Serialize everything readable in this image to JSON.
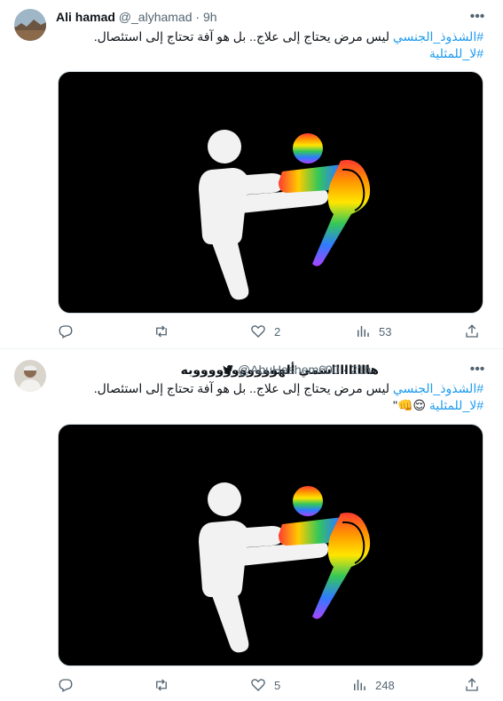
{
  "tweets": [
    {
      "name": "Ali hamad",
      "handle": "@_alyhamad",
      "separator": "·",
      "time": "9h",
      "body_hashtag": "#الشذوذ_الجنسي",
      "body_text": " ليس مرض يحتاج إلى علاج.. بل هو آفة تحتاج إلى استئصال.",
      "body_hashtag2": "#لا_للمثلية",
      "body_suffix": "",
      "replies": "",
      "retweets": "",
      "likes": "2",
      "views": "53"
    },
    {
      "name": "هاااااااااشمي ألهوووووووووووبه",
      "handle": "@AbuHashem600",
      "separator": "·",
      "time": "21h",
      "body_hashtag": "#الشذوذ_الجنسي",
      "body_text": " ليس مرض يحتاج إلى علاج.. بل هو آفة تحتاج إلى استئصال.",
      "body_hashtag2": "#لا_للمثلية",
      "body_suffix": " 😌👊\"",
      "replies": "",
      "retweets": "",
      "likes": "5",
      "views": "248"
    }
  ],
  "icons": {
    "more": "more-horizontal-icon",
    "reply": "reply-icon",
    "retweet": "retweet-icon",
    "like": "heart-icon",
    "views": "views-icon",
    "share": "share-icon"
  },
  "colors": {
    "link": "#1d9bf0",
    "muted": "#536471",
    "media_bg": "#000000"
  }
}
